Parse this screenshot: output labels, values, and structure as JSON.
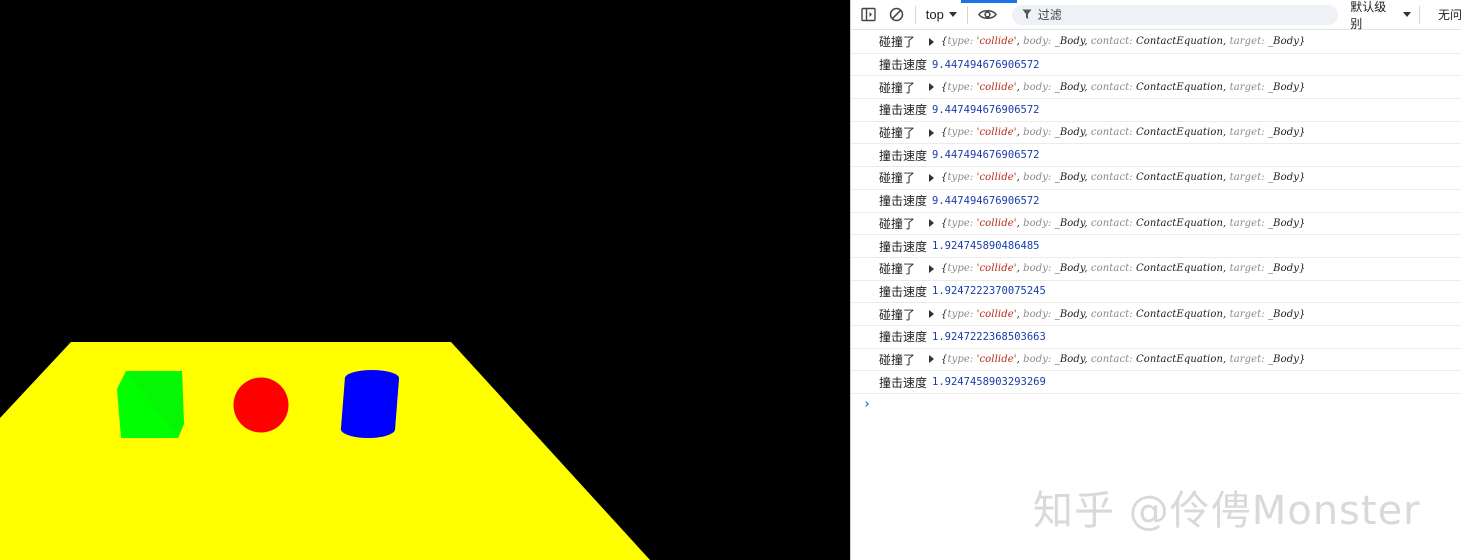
{
  "scene": {
    "background_color": "#000000",
    "ground_color": "#ffff00",
    "objects": [
      {
        "name": "box",
        "shape": "cube",
        "color": "#00ff00"
      },
      {
        "name": "sphere",
        "shape": "sphere",
        "color": "#ff0000"
      },
      {
        "name": "cylinder",
        "shape": "cylinder",
        "color": "#0000ff"
      }
    ]
  },
  "devtools": {
    "toolbar": {
      "sidebar_icon": "sidebar-toggle-icon",
      "clear_icon": "block-icon",
      "context_label": "top",
      "eye_icon": "eye-icon",
      "filter_icon": "funnel-icon",
      "filter_placeholder": "过滤",
      "level_label": "默认级别",
      "issues_label": "无问"
    },
    "entries": [
      {
        "type": "object",
        "label": "碰撞了",
        "obj": {
          "type": "'collide'",
          "body": "_Body",
          "contact": "ContactEquation",
          "target": "_Body"
        }
      },
      {
        "type": "value",
        "label": "撞击速度",
        "value": "9.447494676906572"
      },
      {
        "type": "object",
        "label": "碰撞了",
        "obj": {
          "type": "'collide'",
          "body": "_Body",
          "contact": "ContactEquation",
          "target": "_Body"
        }
      },
      {
        "type": "value",
        "label": "撞击速度",
        "value": "9.447494676906572"
      },
      {
        "type": "object",
        "label": "碰撞了",
        "obj": {
          "type": "'collide'",
          "body": "_Body",
          "contact": "ContactEquation",
          "target": "_Body"
        }
      },
      {
        "type": "value",
        "label": "撞击速度",
        "value": "9.447494676906572"
      },
      {
        "type": "object",
        "label": "碰撞了",
        "obj": {
          "type": "'collide'",
          "body": "_Body",
          "contact": "ContactEquation",
          "target": "_Body"
        }
      },
      {
        "type": "value",
        "label": "撞击速度",
        "value": "9.447494676906572"
      },
      {
        "type": "object",
        "label": "碰撞了",
        "obj": {
          "type": "'collide'",
          "body": "_Body",
          "contact": "ContactEquation",
          "target": "_Body"
        }
      },
      {
        "type": "value",
        "label": "撞击速度",
        "value": "1.924745890486485"
      },
      {
        "type": "object",
        "label": "碰撞了",
        "obj": {
          "type": "'collide'",
          "body": "_Body",
          "contact": "ContactEquation",
          "target": "_Body"
        }
      },
      {
        "type": "value",
        "label": "撞击速度",
        "value": "1.9247222370075245"
      },
      {
        "type": "object",
        "label": "碰撞了",
        "obj": {
          "type": "'collide'",
          "body": "_Body",
          "contact": "ContactEquation",
          "target": "_Body"
        }
      },
      {
        "type": "value",
        "label": "撞击速度",
        "value": "1.9247222368503663"
      },
      {
        "type": "object",
        "label": "碰撞了",
        "obj": {
          "type": "'collide'",
          "body": "_Body",
          "contact": "ContactEquation",
          "target": "_Body"
        }
      },
      {
        "type": "value",
        "label": "撞击速度",
        "value": "1.9247458903293269"
      }
    ],
    "prompt_symbol": "›"
  },
  "watermark": "知乎 @伶俜Monster"
}
